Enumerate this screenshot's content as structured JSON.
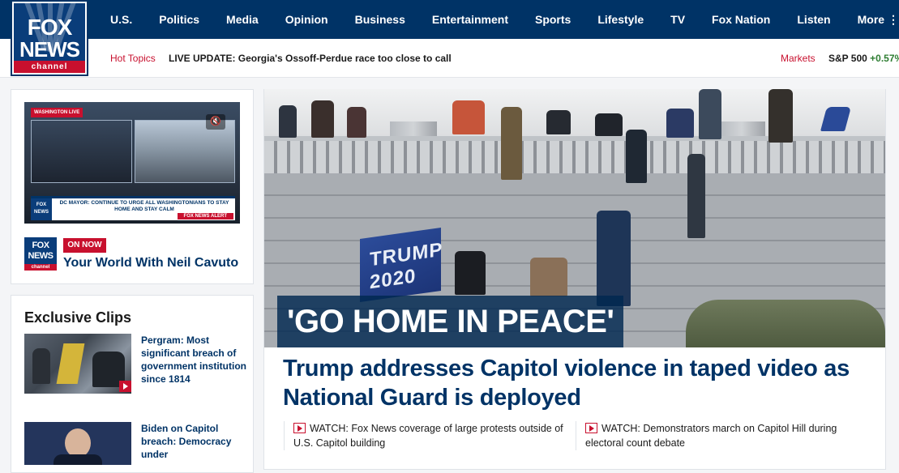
{
  "brand": {
    "logo_top": "FOX",
    "logo_bottom": "NEWS",
    "logo_channel": "channel"
  },
  "nav": {
    "items": [
      "U.S.",
      "Politics",
      "Media",
      "Opinion",
      "Business",
      "Entertainment",
      "Sports",
      "Lifestyle",
      "TV",
      "Fox Nation",
      "Listen"
    ],
    "more": "More ⋮"
  },
  "subbar": {
    "hot_topics": "Hot Topics",
    "live_update": "LIVE UPDATE: Georgia's Ossoff-Perdue race too close to call",
    "markets": "Markets",
    "sp_label": "S&P 500",
    "sp_change": "+0.57%"
  },
  "video": {
    "tag": "WASHINGTON LIVE",
    "lower_third": "DC MAYOR: CONTINUE TO URGE ALL WASHINGTONIANS TO STAY HOME AND STAY CALM",
    "alert": "FOX NEWS ALERT",
    "mute_icon": "🔇"
  },
  "on_now": {
    "badge": "ON NOW",
    "show_title": "Your World With Neil Cavuto",
    "logo_top": "FOX",
    "logo_bottom": "NEWS",
    "logo_channel": "channel"
  },
  "clips": {
    "title": "Exclusive Clips",
    "items": [
      {
        "text": "Pergram: Most significant breach of government institution since 1814"
      },
      {
        "text": "Biden on Capitol breach: Democracy under"
      }
    ]
  },
  "hero": {
    "flag_text": "TRUMP 2020",
    "caption": "'GO HOME IN PEACE'"
  },
  "headline": "Trump addresses Capitol violence in taped video as National Guard is deployed",
  "watch_links": [
    {
      "text": "WATCH: Fox News coverage of large protests outside of U.S. Capitol building"
    },
    {
      "text": "WATCH: Demonstrators march on Capitol Hill during electoral count debate"
    }
  ]
}
